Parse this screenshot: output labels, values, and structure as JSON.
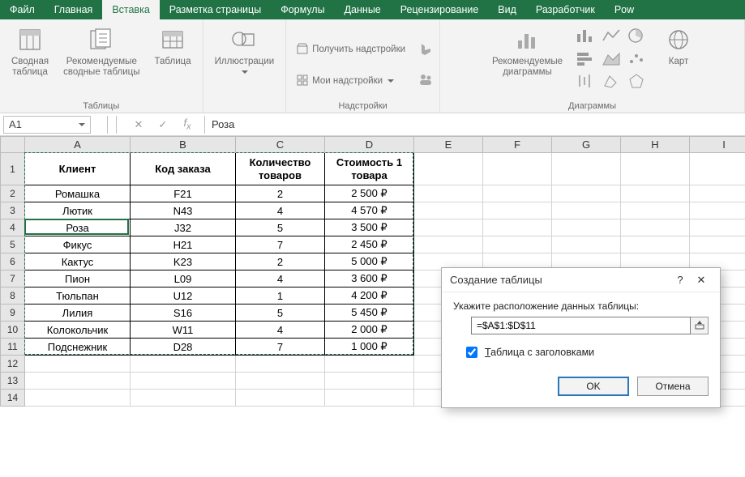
{
  "menubar": {
    "file": "Файл",
    "tabs": [
      "Главная",
      "Вставка",
      "Разметка страницы",
      "Формулы",
      "Данные",
      "Рецензирование",
      "Вид",
      "Разработчик",
      "Pow"
    ],
    "active_index": 1
  },
  "ribbon": {
    "groups": [
      {
        "label": "Таблицы",
        "buttons": [
          {
            "label": "Сводная\nтаблица",
            "icon": "pivot-table"
          },
          {
            "label": "Рекомендуемые\nсводные таблицы",
            "icon": "recommended-pivot"
          },
          {
            "label": "Таблица",
            "icon": "table"
          }
        ]
      },
      {
        "label": "",
        "buttons": [
          {
            "label": "Иллюстрации",
            "icon": "illustrations",
            "dropdown": true
          }
        ]
      },
      {
        "label": "Надстройки",
        "small_buttons": [
          {
            "label": "Получить надстройки",
            "icon": "store"
          },
          {
            "label": "Мои надстройки",
            "icon": "myaddins",
            "dropdown": true
          }
        ],
        "extra_icons": [
          "bing-icon",
          "people-icon"
        ]
      },
      {
        "label": "Диаграммы",
        "buttons_left": [
          {
            "label": "Рекомендуемые\nдиаграммы",
            "icon": "recommended-charts"
          }
        ],
        "mini_icons": [
          "column-chart",
          "line-chart",
          "pie-chart",
          "bar-chart",
          "area-chart",
          "scatter-chart",
          "stock-chart",
          "surface-chart",
          "radar-chart"
        ],
        "maps_label": "Карт"
      }
    ]
  },
  "formula_bar": {
    "name_box": "A1",
    "formula": "Роза"
  },
  "columns": [
    "A",
    "B",
    "C",
    "D",
    "E",
    "F",
    "G",
    "H",
    "I"
  ],
  "row_count": 14,
  "table": {
    "headers": [
      "Клиент",
      "Код заказа",
      "Количество товаров",
      "Стоимость 1 товара"
    ],
    "rows": [
      [
        "Ромашка",
        "F21",
        "2",
        "2 500 ₽"
      ],
      [
        "Лютик",
        "N43",
        "4",
        "4 570 ₽"
      ],
      [
        "Роза",
        "J32",
        "5",
        "3 500 ₽"
      ],
      [
        "Фикус",
        "H21",
        "7",
        "2 450 ₽"
      ],
      [
        "Кактус",
        "K23",
        "2",
        "5 000 ₽"
      ],
      [
        "Пион",
        "L09",
        "4",
        "3 600 ₽"
      ],
      [
        "Тюльпан",
        "U12",
        "1",
        "4 200 ₽"
      ],
      [
        "Лилия",
        "S16",
        "5",
        "5 450 ₽"
      ],
      [
        "Колокольчик",
        "W11",
        "4",
        "2 000 ₽"
      ],
      [
        "Подснежник",
        "D28",
        "7",
        "1 000 ₽"
      ]
    ]
  },
  "dialog": {
    "title": "Создание таблицы",
    "prompt": "Укажите расположение данных таблицы:",
    "range": "=$A$1:$D$11",
    "checkbox_label": "Таблица с заголовками",
    "checkbox_checked": true,
    "ok": "OK",
    "cancel": "Отмена"
  },
  "chart_data": {
    "type": "table",
    "title": "",
    "columns": [
      "Клиент",
      "Код заказа",
      "Количество товаров",
      "Стоимость 1 товара (₽)"
    ],
    "rows": [
      [
        "Ромашка",
        "F21",
        2,
        2500
      ],
      [
        "Лютик",
        "N43",
        4,
        4570
      ],
      [
        "Роза",
        "J32",
        5,
        3500
      ],
      [
        "Фикус",
        "H21",
        7,
        2450
      ],
      [
        "Кактус",
        "K23",
        2,
        5000
      ],
      [
        "Пион",
        "L09",
        4,
        3600
      ],
      [
        "Тюльпан",
        "U12",
        1,
        4200
      ],
      [
        "Лилия",
        "S16",
        5,
        5450
      ],
      [
        "Колокольчик",
        "W11",
        4,
        2000
      ],
      [
        "Подснежник",
        "D28",
        7,
        1000
      ]
    ]
  }
}
